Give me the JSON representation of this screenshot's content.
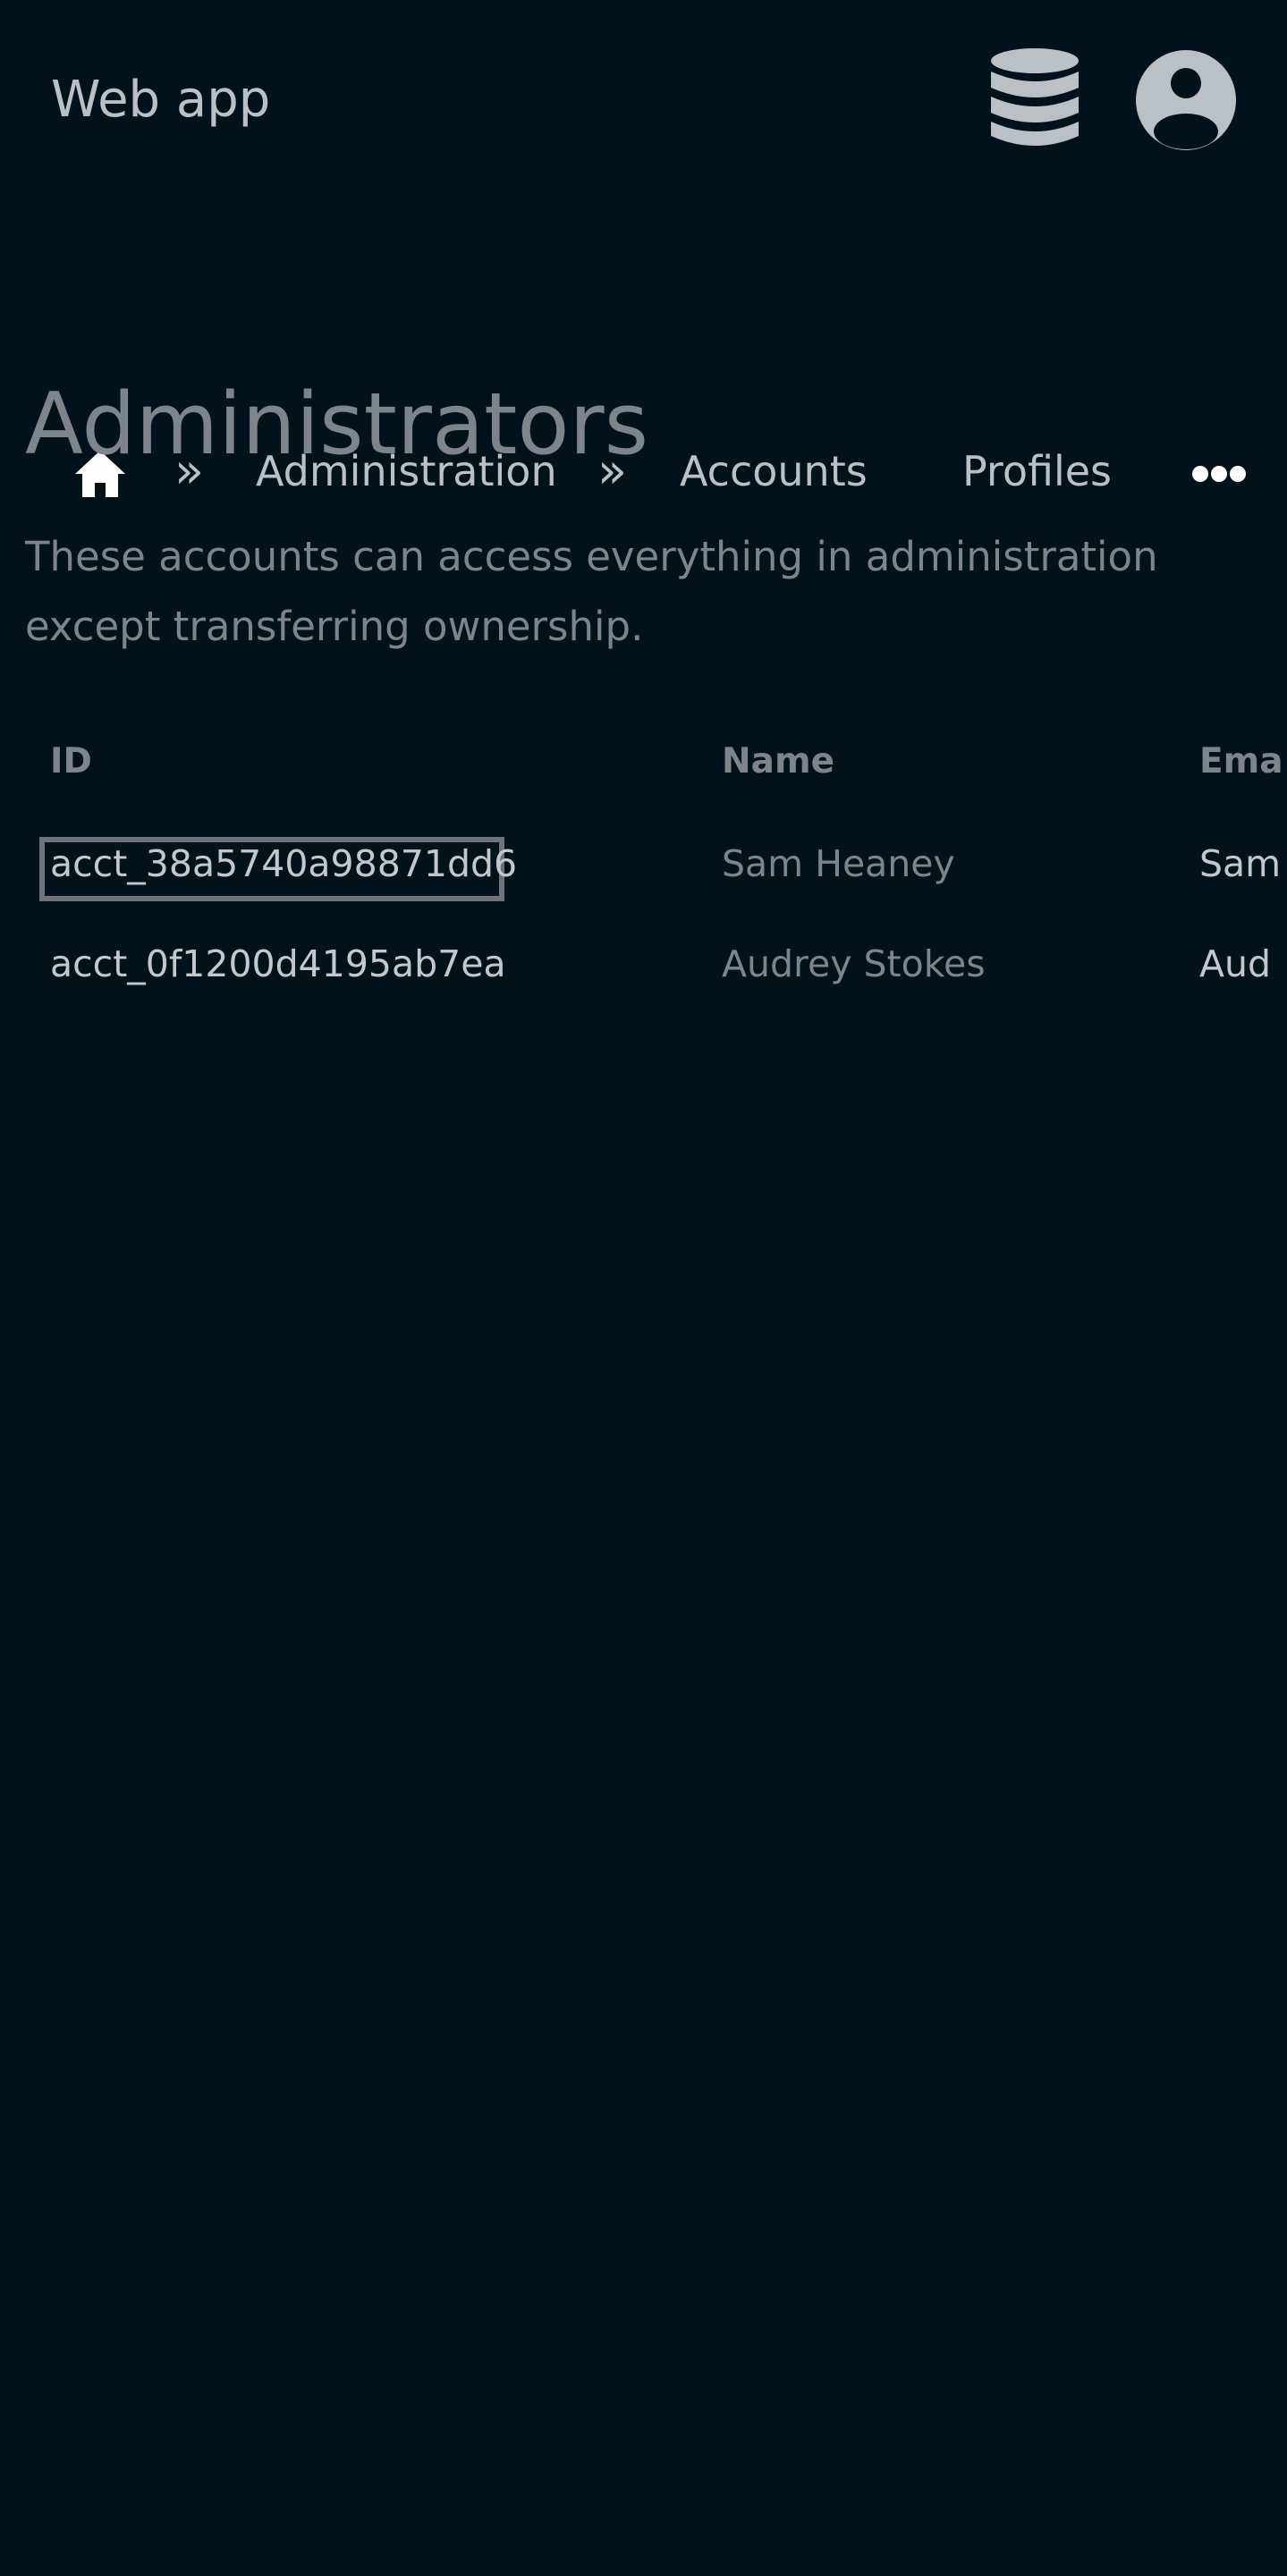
{
  "header": {
    "app_title": "Web app",
    "icons": [
      "database-icon",
      "user-account-icon"
    ]
  },
  "breadcrumb": {
    "home_icon": "home-icon",
    "separator": "»",
    "items": [
      {
        "label": "Administration"
      },
      {
        "label": "Accounts"
      },
      {
        "label": "Profiles"
      }
    ],
    "more_icon": "ellipsis-icon"
  },
  "main": {
    "title": "Administrators",
    "description": "These accounts can access everything in administration except transferring ownership."
  },
  "table": {
    "columns": [
      "ID",
      "Name",
      "Ema"
    ],
    "rows": [
      {
        "id": "acct_38a5740a98871dd6",
        "name": "Sam Heaney",
        "email": "Sam"
      },
      {
        "id": "acct_0f1200d4195ab7ea",
        "name": "Audrey Stokes",
        "email": "Aud"
      }
    ],
    "focused_row": 0
  },
  "colors": {
    "background": "#02121a",
    "text_primary": "#b9c1c5",
    "text_muted": "#7c8589",
    "focus_outline": "#6c7479"
  }
}
